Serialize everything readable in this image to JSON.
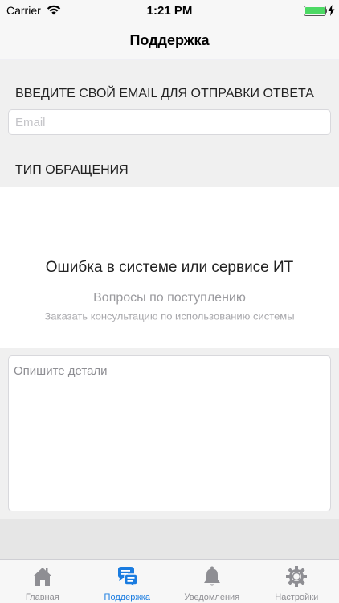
{
  "status_bar": {
    "carrier": "Carrier",
    "time": "1:21 PM"
  },
  "nav": {
    "title": "Поддержка"
  },
  "email_section": {
    "header": "ВВЕДИТЕ СВОЙ EMAIL ДЛЯ ОТПРАВКИ ОТВЕТА",
    "placeholder": "Email"
  },
  "type_section": {
    "header": "ТИП ОБРАЩЕНИЯ",
    "selected": "Ошибка в системе или сервисе ИТ",
    "options": [
      "Вопросы по поступлению",
      "Заказать консультацию по использованию системы"
    ]
  },
  "details": {
    "placeholder": "Опишите детали"
  },
  "tabs": [
    {
      "label": "Главная",
      "icon": "home-icon",
      "active": false
    },
    {
      "label": "Поддержка",
      "icon": "support-chat-icon",
      "active": true
    },
    {
      "label": "Уведомления",
      "icon": "bell-icon",
      "active": false
    },
    {
      "label": "Настройки",
      "icon": "gear-icon",
      "active": false
    }
  ],
  "colors": {
    "accent": "#1a7ce0",
    "battery": "#4cd964",
    "inactive": "#8e8e93"
  }
}
